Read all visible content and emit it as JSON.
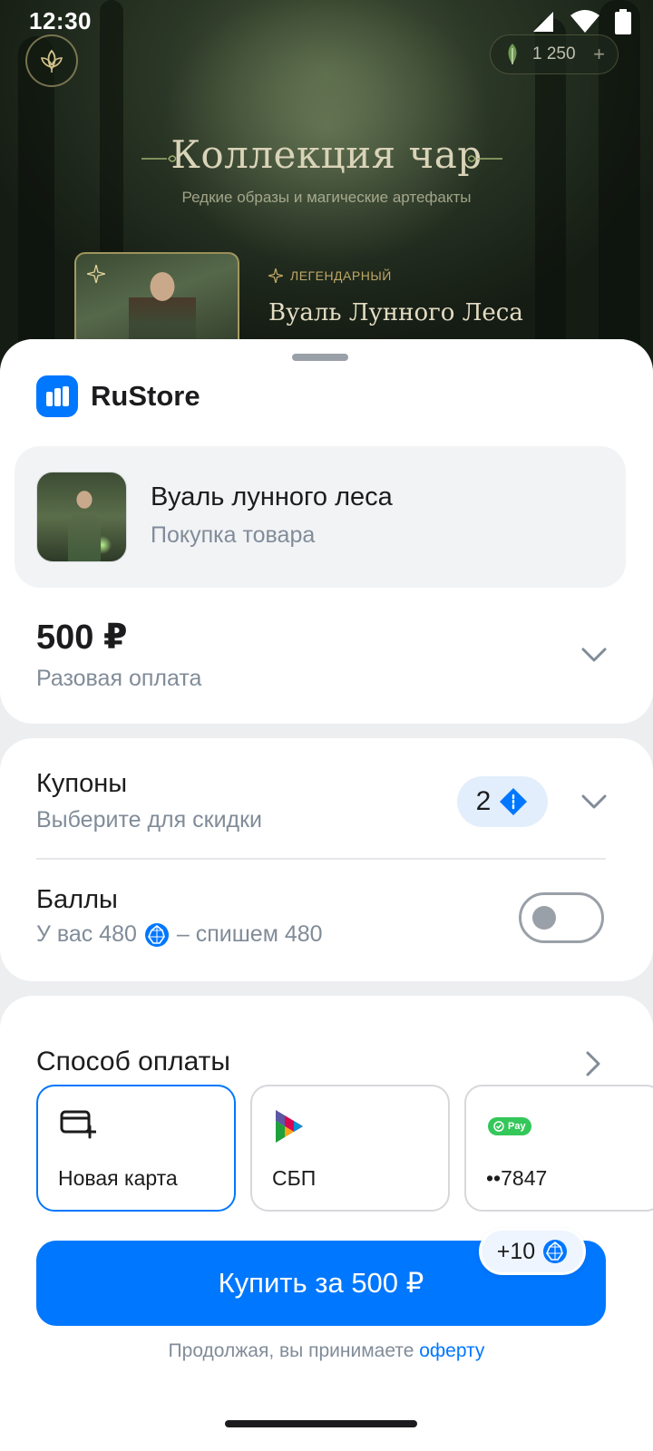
{
  "status_bar": {
    "time": "12:30"
  },
  "game": {
    "currency_amount": "1 250",
    "currency_plus": "+",
    "title": "Коллекция чар",
    "subtitle": "Редкие образы и магические артефакты",
    "rarity": "ЛЕГЕНДАРНЫЙ",
    "item_name": "Вуаль Лунного Леса"
  },
  "sheet": {
    "brand": "RuStore",
    "product": {
      "title": "Вуаль лунного леса",
      "subtitle": "Покупка товара"
    },
    "price": {
      "amount": "500 ₽",
      "type": "Разовая оплата"
    },
    "coupons": {
      "title": "Купоны",
      "subtitle": "Выберите для скидки",
      "count": "2"
    },
    "points": {
      "title": "Баллы",
      "prefix": "У вас 480",
      "suffix": "– спишем 480",
      "toggle_on": false
    },
    "payment": {
      "title": "Способ оплаты",
      "methods": [
        {
          "label": "Новая карта",
          "icon": "add-card-icon",
          "selected": true
        },
        {
          "label": "СБП",
          "icon": "sbp-logo-icon",
          "selected": false
        },
        {
          "label": "••7847",
          "icon": "pay-badge-icon",
          "badge": "Pay",
          "selected": false
        }
      ]
    },
    "buy_button": "Купить за 500 ₽",
    "bonus": "+10",
    "legal": {
      "text": "Продолжая, вы принимаете ",
      "link": "оферту"
    }
  },
  "colors": {
    "accent": "#0077ff",
    "secondary_text": "#818c99",
    "sheet_bg": "#edeef0"
  }
}
